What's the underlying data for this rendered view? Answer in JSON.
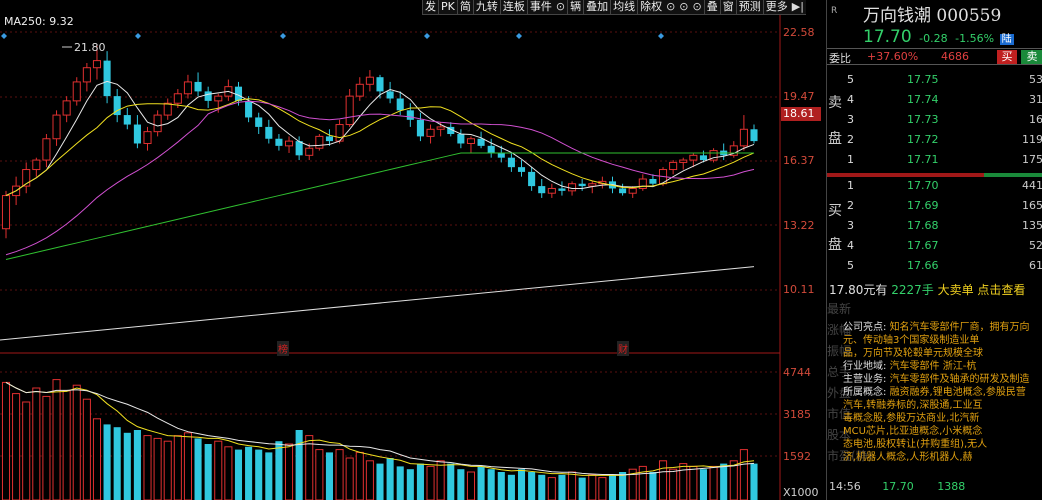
{
  "toolbar": {
    "items": [
      "发",
      "PK",
      "简",
      "九转",
      "连板",
      "事件",
      "",
      "辆",
      "叠加",
      "均线",
      "除权",
      "",
      "",
      "",
      "叠",
      "窗",
      "预测",
      "更多"
    ],
    "more_icon": "play-pause-icon"
  },
  "chart": {
    "ma_label": "MA250: 9.32",
    "y_ticks": [
      "22.58",
      "19.47",
      "16.37",
      "13.22",
      "10.11"
    ],
    "price_marker": "18.61",
    "high_label": "21.80",
    "vol_ticks": [
      "4744",
      "3185",
      "1592"
    ],
    "vol_unit": "X1000",
    "event_tags": [
      "榜",
      "财"
    ],
    "colors": {
      "up": "#e03030",
      "down": "#30c8e0",
      "ma5": "#e8e8e8",
      "ma10": "#f0e020",
      "ma20": "#d050d0",
      "ma60": "#30c030",
      "ma250": "#e0e0e0"
    }
  },
  "chart_data": {
    "type": "candlestick",
    "candles": [
      [
        14.0,
        15.6,
        13.6,
        15.4
      ],
      [
        15.4,
        16.2,
        15.0,
        15.8
      ],
      [
        15.8,
        16.8,
        15.5,
        16.5
      ],
      [
        16.5,
        17.0,
        16.2,
        16.9
      ],
      [
        16.9,
        18.0,
        16.6,
        17.8
      ],
      [
        17.8,
        19.0,
        17.5,
        18.8
      ],
      [
        18.8,
        19.6,
        18.5,
        19.4
      ],
      [
        19.4,
        20.4,
        19.2,
        20.2
      ],
      [
        20.2,
        21.0,
        19.8,
        20.8
      ],
      [
        20.8,
        21.8,
        20.3,
        21.1
      ],
      [
        21.1,
        21.5,
        19.3,
        19.6
      ],
      [
        19.6,
        19.9,
        18.5,
        18.8
      ],
      [
        18.8,
        19.1,
        18.2,
        18.4
      ],
      [
        18.4,
        18.8,
        17.4,
        17.6
      ],
      [
        17.6,
        18.3,
        17.3,
        18.1
      ],
      [
        18.1,
        19.0,
        17.9,
        18.8
      ],
      [
        18.8,
        19.5,
        18.6,
        19.3
      ],
      [
        19.3,
        19.9,
        19.1,
        19.7
      ],
      [
        19.7,
        20.5,
        19.5,
        20.2
      ],
      [
        20.2,
        20.6,
        19.6,
        19.8
      ],
      [
        19.8,
        20.0,
        19.1,
        19.4
      ],
      [
        19.4,
        19.7,
        18.9,
        19.6
      ],
      [
        19.6,
        20.3,
        19.4,
        20.0
      ],
      [
        20.0,
        20.2,
        19.2,
        19.4
      ],
      [
        19.4,
        19.6,
        18.5,
        18.7
      ],
      [
        18.7,
        18.9,
        18.0,
        18.3
      ],
      [
        18.3,
        18.6,
        17.6,
        17.8
      ],
      [
        17.8,
        18.0,
        17.3,
        17.5
      ],
      [
        17.5,
        17.9,
        17.2,
        17.7
      ],
      [
        17.7,
        17.9,
        16.9,
        17.1
      ],
      [
        17.1,
        17.6,
        16.9,
        17.4
      ],
      [
        17.4,
        18.0,
        17.3,
        17.9
      ],
      [
        17.9,
        18.2,
        17.5,
        17.7
      ],
      [
        17.7,
        18.6,
        17.6,
        18.4
      ],
      [
        18.4,
        19.9,
        18.3,
        19.6
      ],
      [
        19.6,
        20.4,
        19.4,
        20.1
      ],
      [
        20.1,
        20.7,
        19.8,
        20.4
      ],
      [
        20.4,
        20.5,
        19.5,
        19.8
      ],
      [
        19.8,
        20.2,
        19.3,
        19.5
      ],
      [
        19.5,
        19.8,
        18.8,
        19.0
      ],
      [
        19.0,
        19.3,
        18.3,
        18.6
      ],
      [
        18.6,
        18.9,
        17.7,
        17.9
      ],
      [
        17.9,
        18.4,
        17.6,
        18.2
      ],
      [
        18.2,
        18.5,
        17.9,
        18.3
      ],
      [
        18.3,
        18.5,
        17.9,
        18.0
      ],
      [
        18.0,
        18.2,
        17.4,
        17.6
      ],
      [
        17.6,
        17.9,
        17.2,
        17.8
      ],
      [
        17.8,
        18.1,
        17.4,
        17.5
      ],
      [
        17.5,
        17.8,
        17.0,
        17.2
      ],
      [
        17.2,
        17.5,
        16.8,
        17.0
      ],
      [
        17.0,
        17.2,
        16.4,
        16.6
      ],
      [
        16.6,
        16.9,
        16.2,
        16.4
      ],
      [
        16.4,
        16.6,
        15.6,
        15.8
      ],
      [
        15.8,
        16.1,
        15.3,
        15.5
      ],
      [
        15.5,
        15.9,
        15.3,
        15.7
      ],
      [
        15.7,
        16.0,
        15.4,
        15.6
      ],
      [
        15.6,
        16.0,
        15.4,
        15.9
      ],
      [
        15.9,
        16.1,
        15.6,
        15.8
      ],
      [
        15.8,
        16.0,
        15.5,
        15.9
      ],
      [
        15.9,
        16.2,
        15.7,
        16.0
      ],
      [
        16.0,
        16.2,
        15.5,
        15.7
      ],
      [
        15.7,
        15.9,
        15.4,
        15.5
      ],
      [
        15.5,
        15.8,
        15.3,
        15.7
      ],
      [
        15.7,
        16.3,
        15.6,
        16.1
      ],
      [
        16.1,
        16.3,
        15.8,
        15.9
      ],
      [
        15.9,
        16.6,
        15.8,
        16.5
      ],
      [
        16.5,
        16.9,
        16.3,
        16.8
      ],
      [
        16.8,
        17.0,
        16.5,
        16.9
      ],
      [
        16.9,
        17.2,
        16.6,
        17.1
      ],
      [
        17.1,
        17.3,
        16.8,
        16.9
      ],
      [
        16.9,
        17.4,
        16.8,
        17.3
      ],
      [
        17.3,
        17.6,
        16.9,
        17.1
      ],
      [
        17.1,
        17.7,
        17.0,
        17.5
      ],
      [
        17.5,
        18.8,
        17.3,
        18.2
      ],
      [
        18.2,
        18.4,
        17.6,
        17.7
      ]
    ],
    "volume": [
      4200,
      3800,
      3500,
      4000,
      3700,
      4300,
      3900,
      4100,
      3600,
      2900,
      2700,
      2600,
      2400,
      2500,
      2300,
      2200,
      2100,
      2300,
      2400,
      2200,
      2000,
      2100,
      1900,
      1800,
      1900,
      1800,
      1700,
      2100,
      2000,
      2500,
      2300,
      1800,
      1700,
      1800,
      1500,
      1700,
      1400,
      1300,
      1500,
      1200,
      1100,
      1300,
      1200,
      1400,
      1300,
      1100,
      1000,
      1200,
      1100,
      1000,
      900,
      1100,
      1000,
      900,
      800,
      900,
      1000,
      800,
      900,
      800,
      900,
      1000,
      1100,
      1200,
      1000,
      1400,
      1100,
      1300,
      1200,
      1100,
      1200,
      1300,
      1400,
      1800,
      1300
    ],
    "ylim": [
      9.3,
      22.9
    ],
    "vol_max": 5000
  },
  "panel": {
    "r_mark": "R",
    "title": "万向钱潮 000559",
    "price": "17.70",
    "change": "-0.28",
    "change_pct": "-1.56%",
    "tag": "陆",
    "webi_label": "委比",
    "webi_value": "+37.60%",
    "webi_diff": "4686",
    "buy_btn": "买",
    "sell_btn": "卖",
    "sell_side": [
      "卖",
      "盘"
    ],
    "buy_side": [
      "买",
      "盘"
    ],
    "sell_levels": [
      {
        "lvl": "5",
        "price": "17.75",
        "vol": "53"
      },
      {
        "lvl": "4",
        "price": "17.74",
        "vol": "31"
      },
      {
        "lvl": "3",
        "price": "17.73",
        "vol": "16"
      },
      {
        "lvl": "2",
        "price": "17.72",
        "vol": "119"
      },
      {
        "lvl": "1",
        "price": "17.71",
        "vol": "175"
      }
    ],
    "buy_levels": [
      {
        "lvl": "1",
        "price": "17.70",
        "vol": "441"
      },
      {
        "lvl": "2",
        "price": "17.69",
        "vol": "165"
      },
      {
        "lvl": "3",
        "price": "17.68",
        "vol": "135"
      },
      {
        "lvl": "4",
        "price": "17.67",
        "vol": "52"
      },
      {
        "lvl": "5",
        "price": "17.66",
        "vol": "61"
      }
    ],
    "big_order": {
      "a": "17.80元有",
      "b": "2227手",
      "c": "大卖单 点击查看"
    },
    "profile": [
      {
        "k": "公司亮点:",
        "v": "知名汽车零部件厂商，拥有万向"
      },
      {
        "k": "",
        "v": "元、传动轴3个国家级制造业单"
      },
      {
        "k": "",
        "v": "品，万向节及轮毂单元规模全球"
      },
      {
        "k": "行业地域:",
        "v": "汽车零部件 浙江-杭"
      },
      {
        "k": "主营业务:",
        "v": "汽车零部件及轴承的研发及制造"
      },
      {
        "k": "所属概念:",
        "v": "融资融券,锂电池概念,参股民营"
      },
      {
        "k": "",
        "v": "汽车,转融券标的,深股通,工业互"
      },
      {
        "k": "",
        "v": "毒概念股,参股万达商业,北汽新"
      },
      {
        "k": "",
        "v": "MCU芯片,比亚迪概念,小米概念"
      },
      {
        "k": "",
        "v": "态电池,股权转让(并购重组),无人"
      },
      {
        "k": "",
        "v": "济,机器人概念,人形机器人,赫"
      }
    ],
    "ghost_labels": [
      "最新",
      "涨幅",
      "振幅",
      "总手",
      "外盘",
      "市值",
      "股本",
      "市盈(静)"
    ],
    "bottom": {
      "time": "14:56",
      "price": "17.70",
      "vol": "1388"
    }
  }
}
